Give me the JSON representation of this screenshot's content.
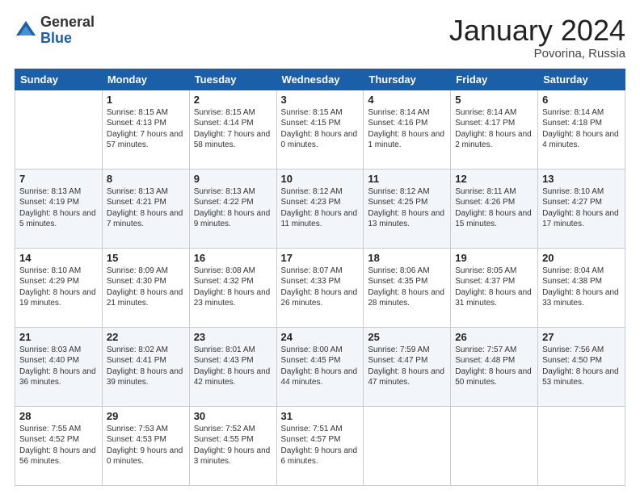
{
  "header": {
    "logo_general": "General",
    "logo_blue": "Blue",
    "month_title": "January 2024",
    "location": "Povorina, Russia"
  },
  "days_of_week": [
    "Sunday",
    "Monday",
    "Tuesday",
    "Wednesday",
    "Thursday",
    "Friday",
    "Saturday"
  ],
  "weeks": [
    [
      {
        "day": "",
        "sunrise": "",
        "sunset": "",
        "daylight": ""
      },
      {
        "day": "1",
        "sunrise": "Sunrise: 8:15 AM",
        "sunset": "Sunset: 4:13 PM",
        "daylight": "Daylight: 7 hours and 57 minutes."
      },
      {
        "day": "2",
        "sunrise": "Sunrise: 8:15 AM",
        "sunset": "Sunset: 4:14 PM",
        "daylight": "Daylight: 7 hours and 58 minutes."
      },
      {
        "day": "3",
        "sunrise": "Sunrise: 8:15 AM",
        "sunset": "Sunset: 4:15 PM",
        "daylight": "Daylight: 8 hours and 0 minutes."
      },
      {
        "day": "4",
        "sunrise": "Sunrise: 8:14 AM",
        "sunset": "Sunset: 4:16 PM",
        "daylight": "Daylight: 8 hours and 1 minute."
      },
      {
        "day": "5",
        "sunrise": "Sunrise: 8:14 AM",
        "sunset": "Sunset: 4:17 PM",
        "daylight": "Daylight: 8 hours and 2 minutes."
      },
      {
        "day": "6",
        "sunrise": "Sunrise: 8:14 AM",
        "sunset": "Sunset: 4:18 PM",
        "daylight": "Daylight: 8 hours and 4 minutes."
      }
    ],
    [
      {
        "day": "7",
        "sunrise": "Sunrise: 8:13 AM",
        "sunset": "Sunset: 4:19 PM",
        "daylight": "Daylight: 8 hours and 5 minutes."
      },
      {
        "day": "8",
        "sunrise": "Sunrise: 8:13 AM",
        "sunset": "Sunset: 4:21 PM",
        "daylight": "Daylight: 8 hours and 7 minutes."
      },
      {
        "day": "9",
        "sunrise": "Sunrise: 8:13 AM",
        "sunset": "Sunset: 4:22 PM",
        "daylight": "Daylight: 8 hours and 9 minutes."
      },
      {
        "day": "10",
        "sunrise": "Sunrise: 8:12 AM",
        "sunset": "Sunset: 4:23 PM",
        "daylight": "Daylight: 8 hours and 11 minutes."
      },
      {
        "day": "11",
        "sunrise": "Sunrise: 8:12 AM",
        "sunset": "Sunset: 4:25 PM",
        "daylight": "Daylight: 8 hours and 13 minutes."
      },
      {
        "day": "12",
        "sunrise": "Sunrise: 8:11 AM",
        "sunset": "Sunset: 4:26 PM",
        "daylight": "Daylight: 8 hours and 15 minutes."
      },
      {
        "day": "13",
        "sunrise": "Sunrise: 8:10 AM",
        "sunset": "Sunset: 4:27 PM",
        "daylight": "Daylight: 8 hours and 17 minutes."
      }
    ],
    [
      {
        "day": "14",
        "sunrise": "Sunrise: 8:10 AM",
        "sunset": "Sunset: 4:29 PM",
        "daylight": "Daylight: 8 hours and 19 minutes."
      },
      {
        "day": "15",
        "sunrise": "Sunrise: 8:09 AM",
        "sunset": "Sunset: 4:30 PM",
        "daylight": "Daylight: 8 hours and 21 minutes."
      },
      {
        "day": "16",
        "sunrise": "Sunrise: 8:08 AM",
        "sunset": "Sunset: 4:32 PM",
        "daylight": "Daylight: 8 hours and 23 minutes."
      },
      {
        "day": "17",
        "sunrise": "Sunrise: 8:07 AM",
        "sunset": "Sunset: 4:33 PM",
        "daylight": "Daylight: 8 hours and 26 minutes."
      },
      {
        "day": "18",
        "sunrise": "Sunrise: 8:06 AM",
        "sunset": "Sunset: 4:35 PM",
        "daylight": "Daylight: 8 hours and 28 minutes."
      },
      {
        "day": "19",
        "sunrise": "Sunrise: 8:05 AM",
        "sunset": "Sunset: 4:37 PM",
        "daylight": "Daylight: 8 hours and 31 minutes."
      },
      {
        "day": "20",
        "sunrise": "Sunrise: 8:04 AM",
        "sunset": "Sunset: 4:38 PM",
        "daylight": "Daylight: 8 hours and 33 minutes."
      }
    ],
    [
      {
        "day": "21",
        "sunrise": "Sunrise: 8:03 AM",
        "sunset": "Sunset: 4:40 PM",
        "daylight": "Daylight: 8 hours and 36 minutes."
      },
      {
        "day": "22",
        "sunrise": "Sunrise: 8:02 AM",
        "sunset": "Sunset: 4:41 PM",
        "daylight": "Daylight: 8 hours and 39 minutes."
      },
      {
        "day": "23",
        "sunrise": "Sunrise: 8:01 AM",
        "sunset": "Sunset: 4:43 PM",
        "daylight": "Daylight: 8 hours and 42 minutes."
      },
      {
        "day": "24",
        "sunrise": "Sunrise: 8:00 AM",
        "sunset": "Sunset: 4:45 PM",
        "daylight": "Daylight: 8 hours and 44 minutes."
      },
      {
        "day": "25",
        "sunrise": "Sunrise: 7:59 AM",
        "sunset": "Sunset: 4:47 PM",
        "daylight": "Daylight: 8 hours and 47 minutes."
      },
      {
        "day": "26",
        "sunrise": "Sunrise: 7:57 AM",
        "sunset": "Sunset: 4:48 PM",
        "daylight": "Daylight: 8 hours and 50 minutes."
      },
      {
        "day": "27",
        "sunrise": "Sunrise: 7:56 AM",
        "sunset": "Sunset: 4:50 PM",
        "daylight": "Daylight: 8 hours and 53 minutes."
      }
    ],
    [
      {
        "day": "28",
        "sunrise": "Sunrise: 7:55 AM",
        "sunset": "Sunset: 4:52 PM",
        "daylight": "Daylight: 8 hours and 56 minutes."
      },
      {
        "day": "29",
        "sunrise": "Sunrise: 7:53 AM",
        "sunset": "Sunset: 4:53 PM",
        "daylight": "Daylight: 9 hours and 0 minutes."
      },
      {
        "day": "30",
        "sunrise": "Sunrise: 7:52 AM",
        "sunset": "Sunset: 4:55 PM",
        "daylight": "Daylight: 9 hours and 3 minutes."
      },
      {
        "day": "31",
        "sunrise": "Sunrise: 7:51 AM",
        "sunset": "Sunset: 4:57 PM",
        "daylight": "Daylight: 9 hours and 6 minutes."
      },
      {
        "day": "",
        "sunrise": "",
        "sunset": "",
        "daylight": ""
      },
      {
        "day": "",
        "sunrise": "",
        "sunset": "",
        "daylight": ""
      },
      {
        "day": "",
        "sunrise": "",
        "sunset": "",
        "daylight": ""
      }
    ]
  ]
}
